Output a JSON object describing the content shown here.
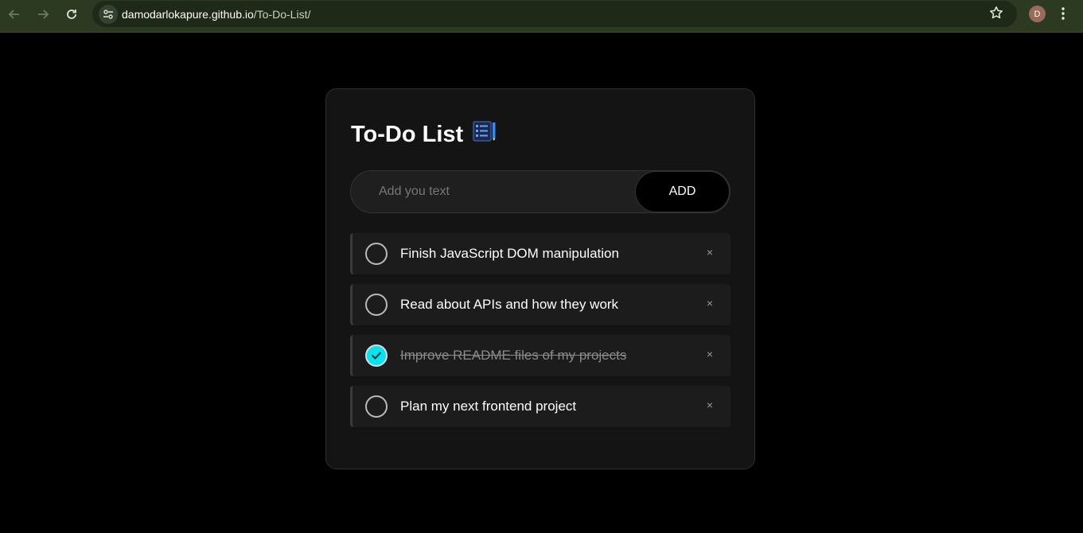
{
  "browser": {
    "url_host": "damodarlokapure.github.io",
    "url_path": "/To-Do-List/",
    "avatar_letter": "D"
  },
  "app": {
    "title": "To-Do List",
    "input_placeholder": "Add you text",
    "input_value": "",
    "add_label": "ADD",
    "accent_color": "#00e5f0"
  },
  "tasks": [
    {
      "text": "Finish JavaScript DOM manipulation",
      "done": false,
      "remove_label": "×"
    },
    {
      "text": "Read about APIs and how they work",
      "done": false,
      "remove_label": "×"
    },
    {
      "text": "Improve README files of my projects",
      "done": true,
      "remove_label": "×"
    },
    {
      "text": "Plan my next frontend project",
      "done": false,
      "remove_label": "×"
    }
  ]
}
